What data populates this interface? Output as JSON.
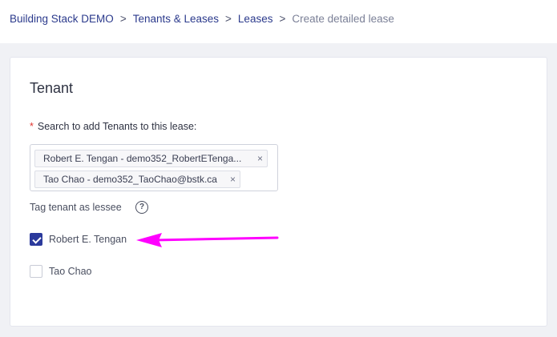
{
  "breadcrumb": {
    "items": [
      {
        "label": "Building Stack DEMO"
      },
      {
        "label": "Tenants & Leases"
      },
      {
        "label": "Leases"
      }
    ],
    "separator": ">",
    "current": "Create detailed lease"
  },
  "tenant_section": {
    "title": "Tenant",
    "search_label": "Search to add Tenants to this lease",
    "required_marker": "*",
    "label_suffix": ":",
    "selected_tenants": [
      {
        "label": "Robert E. Tengan - demo352_RobertETenga...",
        "remove": "×"
      },
      {
        "label": "Tao Chao - demo352_TaoChao@bstk.ca",
        "remove": "×"
      }
    ],
    "lessee_label": "Tag tenant as lessee",
    "help_glyph": "?",
    "lessees": [
      {
        "name": "Robert E. Tengan",
        "checked": true
      },
      {
        "name": "Tao Chao",
        "checked": false
      }
    ]
  },
  "colors": {
    "accent": "#2b3a9c",
    "annotation_arrow": "#ff00ff",
    "required": "#e0342f"
  }
}
